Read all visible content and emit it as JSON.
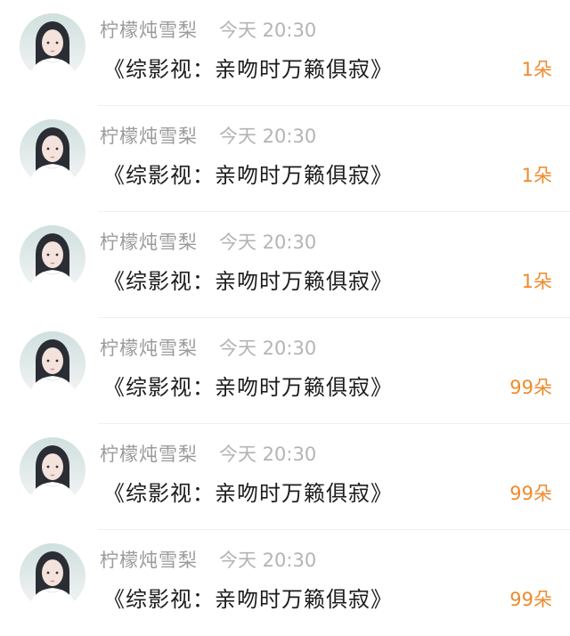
{
  "messages": [
    {
      "username": "柠檬炖雪梨",
      "time": "今天 20:30",
      "title": "《综影视：亲吻时万籁俱寂》",
      "count": "1朵"
    },
    {
      "username": "柠檬炖雪梨",
      "time": "今天 20:30",
      "title": "《综影视：亲吻时万籁俱寂》",
      "count": "1朵"
    },
    {
      "username": "柠檬炖雪梨",
      "time": "今天 20:30",
      "title": "《综影视：亲吻时万籁俱寂》",
      "count": "1朵"
    },
    {
      "username": "柠檬炖雪梨",
      "time": "今天 20:30",
      "title": "《综影视：亲吻时万籁俱寂》",
      "count": "99朵"
    },
    {
      "username": "柠檬炖雪梨",
      "time": "今天 20:30",
      "title": "《综影视：亲吻时万籁俱寂》",
      "count": "99朵"
    },
    {
      "username": "柠檬炖雪梨",
      "time": "今天 20:30",
      "title": "《综影视：亲吻时万籁俱寂》",
      "count": "99朵"
    }
  ],
  "colors": {
    "username": "#9b9b9b",
    "time": "#b4b4b4",
    "title": "#1c1c1c",
    "count": "#f08a2c",
    "divider": "#efefef"
  }
}
